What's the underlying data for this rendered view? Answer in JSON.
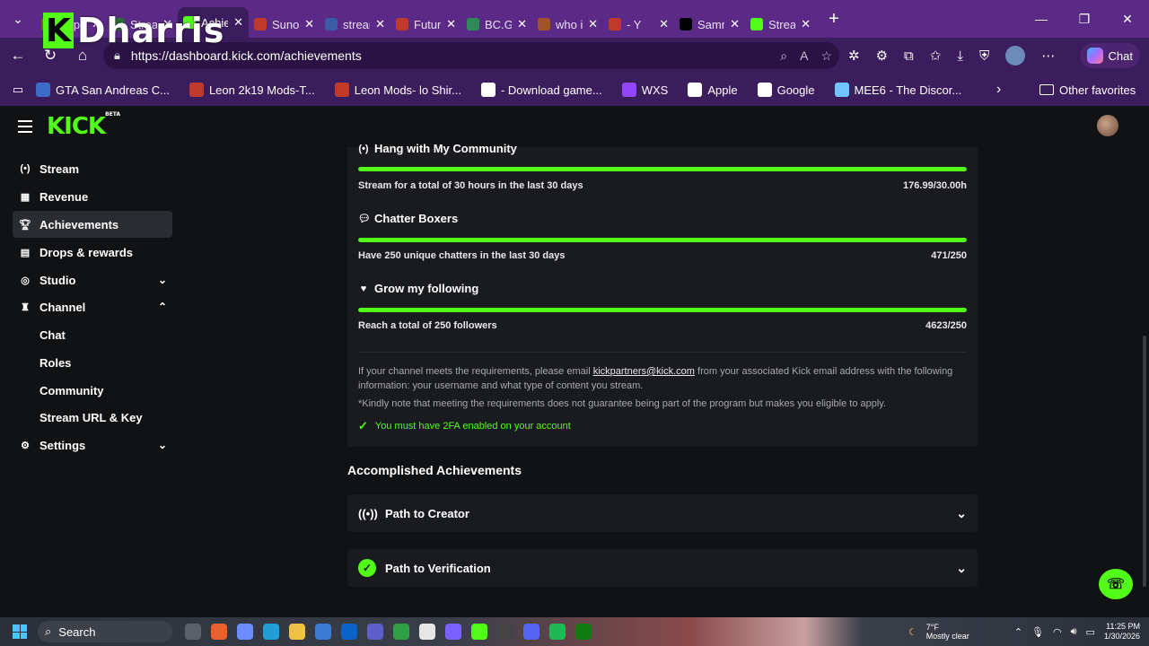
{
  "browser": {
    "tabs": [
      {
        "title": "Super",
        "color": "#7a5c2e"
      },
      {
        "title": "Stream",
        "color": "#2e6b3a"
      },
      {
        "title": "Achievements",
        "color": "#53fc18",
        "active": true
      },
      {
        "title": "Suno",
        "color": "#c0392b"
      },
      {
        "title": "stream",
        "color": "#3b5ba5"
      },
      {
        "title": "Future",
        "color": "#c0392b"
      },
      {
        "title": "BC.GA",
        "color": "#2e8b57"
      },
      {
        "title": "who i",
        "color": "#a0522d"
      },
      {
        "title": "- Y",
        "color": "#c0392b"
      },
      {
        "title": "Samm",
        "color": "#000000"
      },
      {
        "title": "Stream",
        "color": "#53fc18"
      }
    ],
    "url": "https://dashboard.kick.com/achievements",
    "chat_label": "Chat",
    "favorites": [
      {
        "label": "GTA San Andreas C...",
        "color": "#3b6cc9"
      },
      {
        "label": "Leon 2k19 Mods-T...",
        "color": "#c0392b"
      },
      {
        "label": "Leon Mods- lo Shir...",
        "color": "#c0392b"
      },
      {
        "label": "- Download game...",
        "color": "#ffffff"
      },
      {
        "label": "WXS",
        "color": "#9146ff"
      },
      {
        "label": "Apple",
        "color": "#ffffff"
      },
      {
        "label": "Google",
        "color": "#ffffff"
      },
      {
        "label": "MEE6 - The Discor...",
        "color": "#6ec6ff"
      }
    ],
    "other_favorites": "Other favorites"
  },
  "overlay": {
    "name": "Dharris"
  },
  "sidebar": {
    "items": [
      {
        "label": "Stream",
        "icon": "broadcast-icon"
      },
      {
        "label": "Revenue",
        "icon": "dollar-icon"
      },
      {
        "label": "Achievements",
        "icon": "trophy-icon",
        "active": true
      },
      {
        "label": "Drops & rewards",
        "icon": "gift-icon"
      },
      {
        "label": "Studio",
        "icon": "studio-icon"
      },
      {
        "label": "Channel",
        "icon": "channel-icon"
      }
    ],
    "channel_sub": [
      "Chat",
      "Roles",
      "Community",
      "Stream URL & Key"
    ],
    "settings": "Settings"
  },
  "achievements": [
    {
      "title": "Hang with My Community",
      "desc": "Stream for a total of 30 hours in the last 30 days",
      "value": "176.99/30.00h",
      "progress": 1.0
    },
    {
      "title": "Chatter Boxers",
      "desc": "Have 250 unique chatters in the last 30 days",
      "value": "471/250",
      "progress": 1.0
    },
    {
      "title": "Grow my following",
      "desc": "Reach a total of 250 followers",
      "value": "4623/250",
      "progress": 1.0
    }
  ],
  "info": {
    "before_email": "If your channel meets the requirements, please email ",
    "email": "kickpartners@kick.com",
    "after_email": " from your associated Kick email address with the following information: your username and what type of content you stream.",
    "note": "*Kindly note that meeting the requirements does not guarantee being part of the program but makes you eligible to apply.",
    "requirement": "You must have 2FA enabled on your account"
  },
  "accomplished": {
    "heading": "Accomplished Achievements",
    "rows": [
      "Path to Creator",
      "Path to Verification"
    ]
  },
  "taskbar": {
    "search": "Search",
    "weather_temp": "7°F",
    "weather_desc": "Mostly clear",
    "time": "11:25 PM",
    "date": "1/30/2026"
  },
  "colors": {
    "accent": "#53fc18",
    "browser_frame": "#5a2a86",
    "bg": "#111214",
    "card": "#1a1b1f"
  }
}
